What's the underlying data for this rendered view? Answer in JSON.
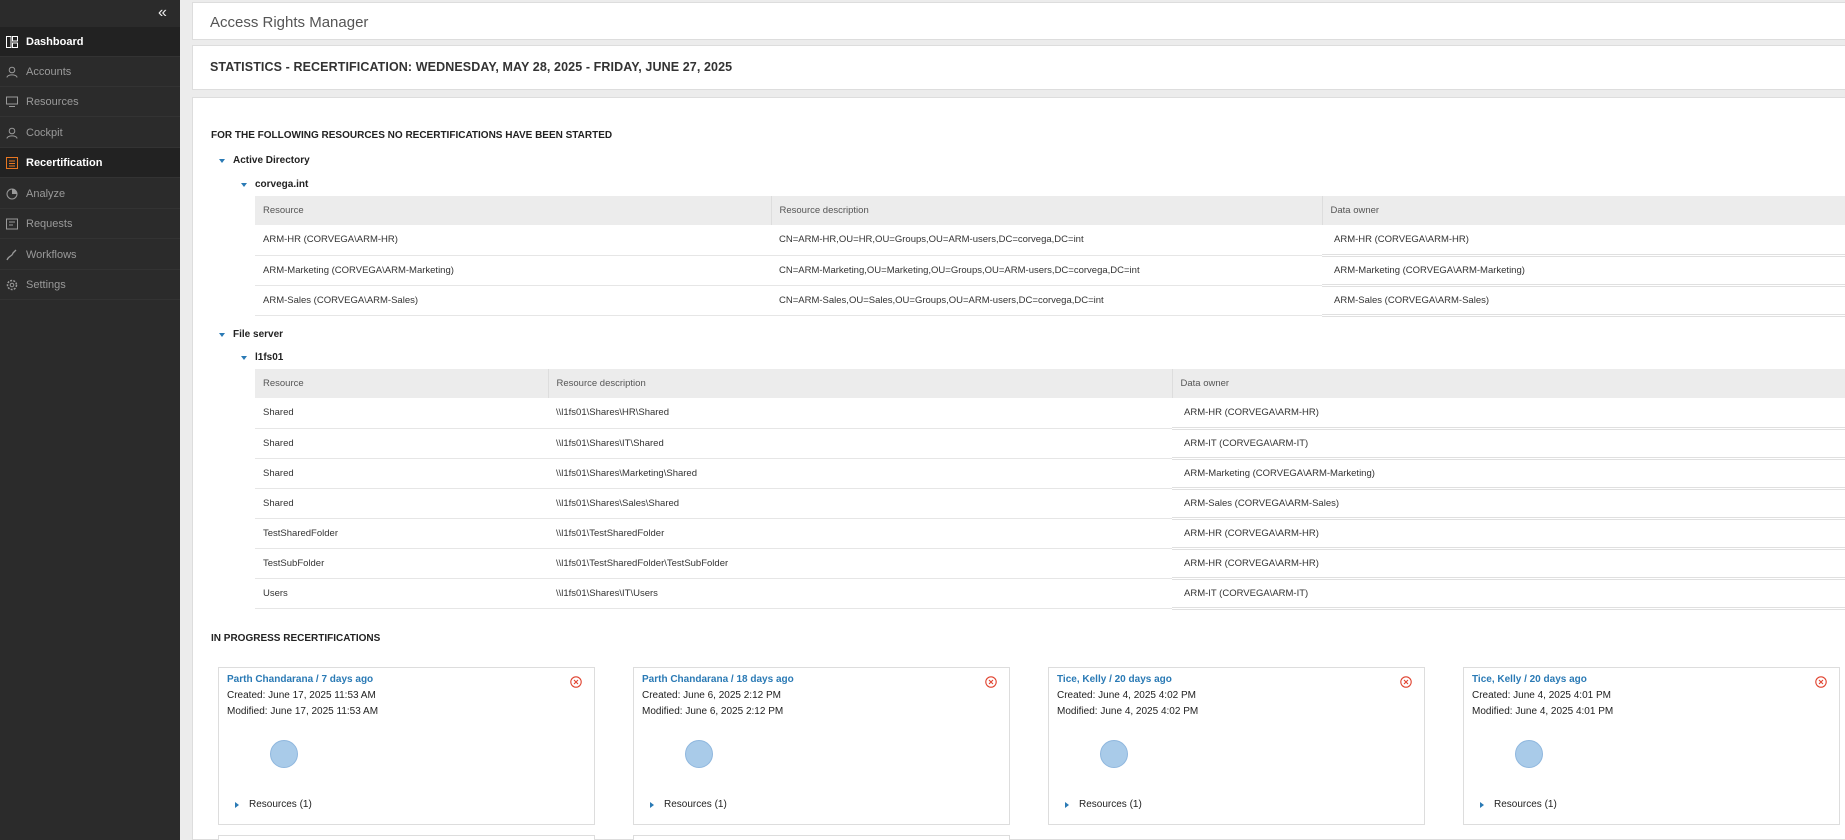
{
  "sidebar": {
    "collapse_glyph": "«",
    "items": [
      {
        "label": "Dashboard",
        "icon": "dashboard-icon"
      },
      {
        "label": "Accounts",
        "icon": "accounts-icon"
      },
      {
        "label": "Resources",
        "icon": "resources-icon"
      },
      {
        "label": "Cockpit",
        "icon": "cockpit-icon"
      },
      {
        "label": "Recertification",
        "icon": "recertification-icon",
        "accent": "#e87722"
      },
      {
        "label": "Analyze",
        "icon": "analyze-icon"
      },
      {
        "label": "Requests",
        "icon": "requests-icon"
      },
      {
        "label": "Workflows",
        "icon": "workflows-icon"
      },
      {
        "label": "Settings",
        "icon": "settings-icon"
      }
    ]
  },
  "header": {
    "title": "Access Rights Manager"
  },
  "stats": {
    "title": "STATISTICS - RECERTIFICATION: WEDNESDAY, MAY 28, 2025 - FRIDAY, JUNE 27, 2025"
  },
  "not_started": {
    "title": "FOR THE FOLLOWING RESOURCES NO RECERTIFICATIONS HAVE BEEN STARTED",
    "groups": [
      {
        "label": "Active Directory",
        "sub_label": "corvega.int",
        "columns": [
          "Resource",
          "Resource description",
          "Data owner"
        ],
        "rows": [
          [
            "ARM-HR (CORVEGA\\ARM-HR)",
            "CN=ARM-HR,OU=HR,OU=Groups,OU=ARM-users,DC=corvega,DC=int",
            "ARM-HR (CORVEGA\\ARM-HR)"
          ],
          [
            "ARM-Marketing (CORVEGA\\ARM-Marketing)",
            "CN=ARM-Marketing,OU=Marketing,OU=Groups,OU=ARM-users,DC=corvega,DC=int",
            "ARM-Marketing (CORVEGA\\ARM-Marketing)"
          ],
          [
            "ARM-Sales (CORVEGA\\ARM-Sales)",
            "CN=ARM-Sales,OU=Sales,OU=Groups,OU=ARM-users,DC=corvega,DC=int",
            "ARM-Sales (CORVEGA\\ARM-Sales)"
          ]
        ]
      },
      {
        "label": "File server",
        "sub_label": "l1fs01",
        "columns": [
          "Resource",
          "Resource description",
          "Data owner"
        ],
        "rows": [
          [
            "Shared",
            "\\\\l1fs01\\Shares\\HR\\Shared",
            "ARM-HR (CORVEGA\\ARM-HR)"
          ],
          [
            "Shared",
            "\\\\l1fs01\\Shares\\IT\\Shared",
            "ARM-IT (CORVEGA\\ARM-IT)"
          ],
          [
            "Shared",
            "\\\\l1fs01\\Shares\\Marketing\\Shared",
            "ARM-Marketing (CORVEGA\\ARM-Marketing)"
          ],
          [
            "Shared",
            "\\\\l1fs01\\Shares\\Sales\\Shared",
            "ARM-Sales (CORVEGA\\ARM-Sales)"
          ],
          [
            "TestSharedFolder",
            "\\\\l1fs01\\TestSharedFolder",
            "ARM-HR (CORVEGA\\ARM-HR)"
          ],
          [
            "TestSubFolder",
            "\\\\l1fs01\\TestSharedFolder\\TestSubFolder",
            "ARM-HR (CORVEGA\\ARM-HR)"
          ],
          [
            "Users",
            "\\\\l1fs01\\Shares\\IT\\Users",
            "ARM-IT (CORVEGA\\ARM-IT)"
          ]
        ]
      }
    ]
  },
  "in_progress": {
    "title": "IN PROGRESS RECERTIFICATIONS",
    "cards": [
      {
        "title": "Parth Chandarana / 7 days ago",
        "created": "Created: June 17, 2025 11:53 AM",
        "modified": "Modified: June 17, 2025 11:53 AM",
        "resources": "Resources (1)"
      },
      {
        "title": "Parth Chandarana / 18 days ago",
        "created": "Created: June 6, 2025 2:12 PM",
        "modified": "Modified: June 6, 2025 2:12 PM",
        "resources": "Resources (1)"
      },
      {
        "title": "Tice, Kelly / 20 days ago",
        "created": "Created: June 4, 2025 4:02 PM",
        "modified": "Modified: June 4, 2025 4:02 PM",
        "resources": "Resources (1)"
      },
      {
        "title": "Tice, Kelly / 20 days ago",
        "created": "Created: June 4, 2025 4:01 PM",
        "modified": "Modified: June 4, 2025 4:01 PM",
        "resources": "Resources (1)"
      }
    ]
  },
  "colors": {
    "accent_orange": "#e87722",
    "link_blue": "#2a7ab5",
    "close_red": "#e0432f",
    "sidebar_bg": "#2b2b2b"
  }
}
